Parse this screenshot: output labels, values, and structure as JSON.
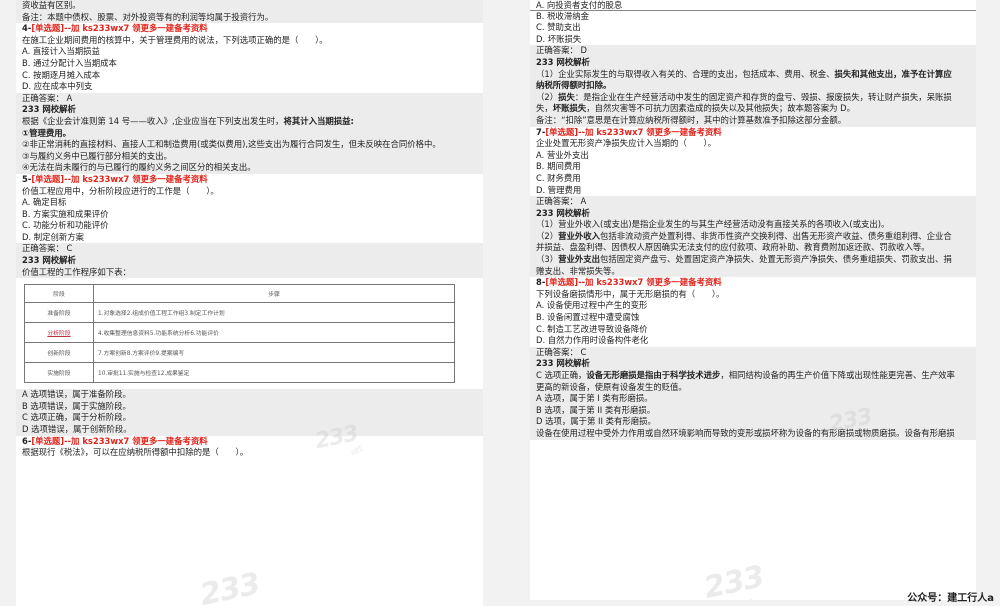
{
  "left": {
    "intro": [
      "资收益有区别。",
      "备注：本题中债权、股票、对外投资等有的利润等均属于投资行为。"
    ],
    "q4": {
      "num": "4-",
      "type": "[单选题]",
      "promo": "--加 ks233wx7 领更多一建备考资料",
      "stem": "在施工企业期间费用的核算中，关于管理费用的说法，下列选项正确的是（　　）。",
      "options": [
        "A. 直接计入当期损益",
        "B. 通过分配计入当期成本",
        "C. 按期逐月摊入成本",
        "D. 应在成本中列支"
      ],
      "answer": "正确答案：  A",
      "analysis_title": "233 网校解析",
      "analysis_lead": "根据《企业会计准则第 14 号——收入》,企业应当在下列支出发生时，",
      "analysis_lead_bold": "将其计入当期损益:",
      "points": [
        "①管理费用。",
        "②非正常消耗的直接材料、直接人工和制造费用(或类似费用),这些支出为履行合同发生，但未反映在合同价格中。",
        "③与履约义务中已履行部分相关的支出。",
        "④无法在尚未履行的与已履行的履约义务之间区分的相关支出。"
      ]
    },
    "q5": {
      "num": "5-",
      "type": "[单选题]",
      "promo": "--加 ks233wx7 领更多一建备考资料",
      "stem": "价值工程应用中，分析阶段应进行的工作是（　　）。",
      "options": [
        "A. 确定目标",
        "B. 方案实施和成果评价",
        "C. 功能分析和功能评价",
        "D. 制定创新方案"
      ],
      "answer": "正确答案：  C",
      "analysis_title": "233 网校解析",
      "analysis_lead": "价值工程的工作程序如下表：",
      "table": {
        "headers": [
          "阶段",
          "步骤"
        ],
        "rows": [
          {
            "stage": "准备阶段",
            "steps": "1.对象选择2.组成价值工程工作组3.制定工作计划"
          },
          {
            "stage": "分析阶段",
            "steps": "4.收集整理信息资料5.功能系统分析6.功能评价"
          },
          {
            "stage": "创新阶段",
            "steps": "7.方案创新8.方案评价9.提案编写"
          },
          {
            "stage": "实施阶段",
            "steps": "10.审批11.实施与检查12.成果鉴定"
          }
        ]
      },
      "explain": [
        "A 选项错误，属于准备阶段。",
        "B 选项错误，属于实施阶段。",
        "C 选项正确，属于分析阶段。",
        "D 选项错误，属于创新阶段。"
      ]
    },
    "q6": {
      "num": "6-",
      "type": "[单选题]",
      "promo": "--加 ks233wx7 领更多一建备考资料",
      "stem": "根据现行《税法》，可以在应纳税所得额中扣除的是（　　）。"
    }
  },
  "right": {
    "q6_options": [
      "A. 向投资者支付的股息",
      "B. 税收滞纳金",
      "C. 赞助支出",
      "D. 坏账损失"
    ],
    "q6_answer": "正确答案：  D",
    "q6_analysis_title": "233 网校解析",
    "q6_analysis": [
      {
        "plain": "（1）企业实际发生的与取得收入有关的、合理的支出，包括成本、费用、税金、",
        "bold": "损失",
        "rest": "和其他支出，准予在计算应"
      },
      {
        "plain": "",
        "bold": "纳税所得额时扣除。",
        "rest": ""
      },
      {
        "plain": "（2）",
        "bold": "损失",
        "rest": "：是指企业在生产经营活动中发生的固定资产和存货的盘亏、毁损、报废损失，转让财产损失，呆账损"
      },
      {
        "plain": "失，",
        "bold": "坏账损失",
        "rest": "，自然灾害等不可抗力因素造成的损失以及其他损失；故本题答案为 D。"
      },
      {
        "plain": "备注：“扣除”意思是在计算应纳税所得额时，其中的计算基数准予扣除这部分金额。",
        "bold": "",
        "rest": ""
      }
    ],
    "q7": {
      "num": "7-",
      "type": "[单选题]",
      "promo": "--加 ks233wx7 领更多一建备考资料",
      "stem": "企业处置无形资产净损失应计入当期的（　　）。",
      "options": [
        "A. 营业外支出",
        "B. 期间费用",
        "C. 财务费用",
        "D. 管理费用"
      ],
      "answer": "正确答案：  A",
      "analysis_title": "233 网校解析",
      "analysis": [
        {
          "plain": "（1）营业外收入(或支出)是指企业发生的与其生产经营活动没有直接关系的各项收入(或支出)。",
          "bold": "",
          "rest": ""
        },
        {
          "plain": "（2）",
          "bold": "营业外收入",
          "rest": "包括非流动资产处置利得、非货币性资产交换利得、出售无形资产收益、债务重组利得、企业合"
        },
        {
          "plain": "并损益、盘盈利得、因债权人原因确实无法支付的应付款项、政府补助、教育费附加返还款、罚款收入等。",
          "bold": "",
          "rest": ""
        },
        {
          "plain": "（3）",
          "bold": "营业外支出",
          "rest": "包括固定资产盘亏、处置固定资产净损失、处置无形资产净损失、债务重组损失、罚款支出、捐"
        },
        {
          "plain": "赠支出、非常损失等。",
          "bold": "",
          "rest": ""
        }
      ]
    },
    "q8": {
      "num": "8-",
      "type": "[单选题]",
      "promo": "--加 ks233wx7 领更多一建备考资料",
      "stem": "下列设备磨损情形中，属于无形磨损的有（　　）。",
      "options": [
        "A. 设备使用过程中产生的变形",
        "B. 设备闲置过程中遭受腐蚀",
        "C. 制造工艺改进导致设备降价",
        "D. 自然力作用时设备构件老化"
      ],
      "answer": "正确答案：  C",
      "analysis_title": "233 网校解析",
      "analysis": [
        {
          "plain": "C 选项正确，",
          "bold": "设备无形磨损是指由于科学技术进步",
          "rest": "，相同结构设备的再生产价值下降或出现性能更完善、生产效率"
        },
        {
          "plain": "更高的新设备，使原有设备发生的贬值。",
          "bold": "",
          "rest": ""
        },
        {
          "plain": "A 选项，属于第 I 类有形磨损。",
          "bold": "",
          "rest": ""
        },
        {
          "plain": "B 选项，属于第 II 类有形磨损。",
          "bold": "",
          "rest": ""
        },
        {
          "plain": "D 选项，属于第 II 类有形磨损。",
          "bold": "",
          "rest": ""
        },
        {
          "plain": "设备在使用过程中受外力作用或自然环境影响而导致的变形或损坏称为设备的有形磨损或物质磨损。设备有形磨损",
          "bold": "",
          "rest": ""
        }
      ]
    }
  },
  "footer": "公众号：建工行人a"
}
